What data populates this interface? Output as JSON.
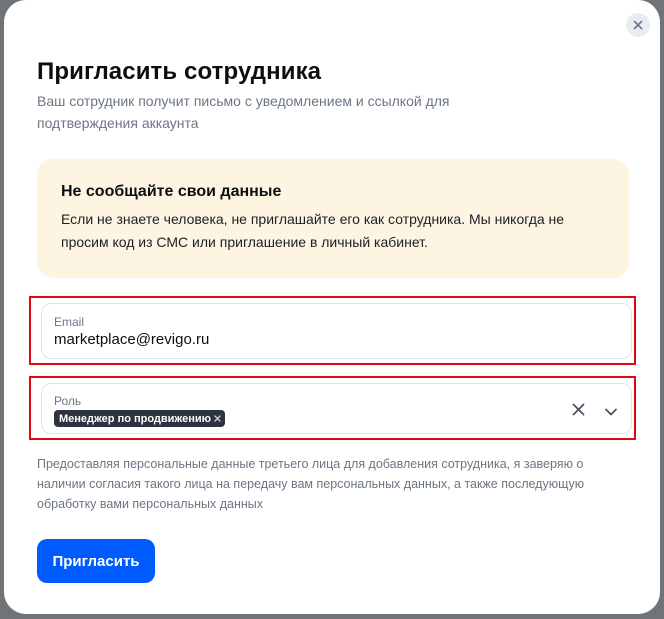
{
  "modal": {
    "title": "Пригласить сотрудника",
    "subtitle": "Ваш сотрудник получит письмо с уведомлением и ссылкой для подтверждения аккаунта",
    "close_icon": "close-icon"
  },
  "notice": {
    "title": "Не сообщайте свои данные",
    "text": "Если не знаете человека, не приглашайте его как сотрудника. Мы никогда не просим код из СМС или приглашение в личный кабинет."
  },
  "email_field": {
    "label": "Email",
    "value": "marketplace@revigo.ru"
  },
  "role_field": {
    "label": "Роль",
    "selected": [
      "Менеджер по продвижению"
    ],
    "clear_icon": "clear-icon",
    "dropdown_icon": "chevron-down-icon"
  },
  "consent_text": "Предоставляя персональные данные третьего лица для добавления сотрудника, я заверяю о наличии согласия такого лица на передачу вам персональных данных, а также последующую обработку вами персональных данных",
  "submit_label": "Пригласить",
  "colors": {
    "accent": "#005bff",
    "notice_bg": "#fdf5e2",
    "highlight_border": "#e30613",
    "chip_bg": "#2d3440"
  }
}
